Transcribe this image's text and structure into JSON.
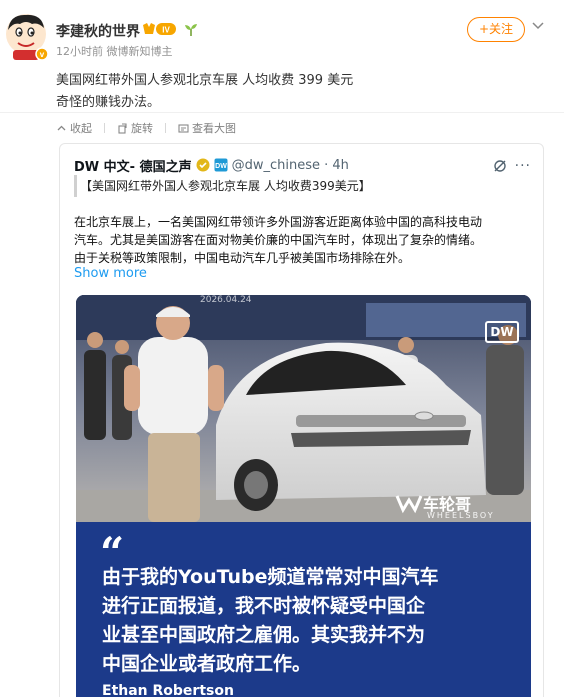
{
  "post": {
    "username": "李建秋的世界",
    "vip_label": "IV",
    "meta": "12小时前 微博新知博主",
    "follow_label": "+关注",
    "text_line1": "美国网红带外国人参观北京车展 人均收费 399 美元",
    "text_line2": "奇怪的赚钱办法。"
  },
  "actions": {
    "collapse": "收起",
    "rotate": "旋转",
    "view_large": "查看大图"
  },
  "card": {
    "author": "DW 中文- 德国之声",
    "handle": "@dw_chinese · 4h",
    "headline": "【美国网红带外国人参观北京车展 人均收费399美元】",
    "body_line1": "在北京车展上，一名美国网红带领许多外国游客近距离体验中国的高科技电动",
    "body_line2": "汽车。尤其是美国游客在面对物美价廉的中国汽车时，体现出了复杂的情绪。",
    "body_line3": "由于关税等政策限制，中国电动汽车几乎被美国市场排除在外。",
    "show_more": "Show more",
    "dots": "···"
  },
  "media": {
    "logo": "DW",
    "watermark": "车轮哥",
    "watermark_sub": "WHEELSBOY",
    "date": "2026.04.24",
    "quote_mark": "“",
    "quote_line1": "由于我的YouTube频道常常对中国汽车",
    "quote_line2": "进行正面报道，我不时被怀疑受中国企",
    "quote_line3": "业甚至中国政府之雇佣。其实我并不为",
    "quote_line4": "中国企业或者政府工作。",
    "quote_author": "Ethan Robertson"
  },
  "colors": {
    "accent": "#ff8200",
    "link": "#1d9bf0",
    "quote_bg": "#1c3a8a"
  }
}
